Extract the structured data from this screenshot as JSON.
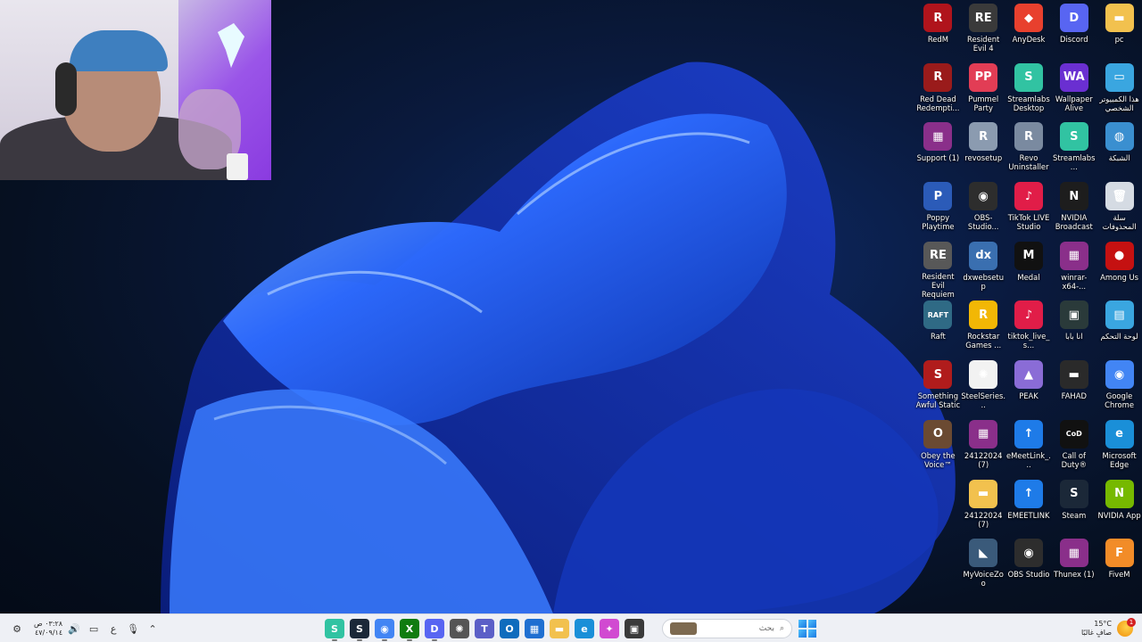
{
  "desktop": {
    "icons": [
      {
        "label": "RedM",
        "glyph": "R",
        "color": "#b0141c"
      },
      {
        "label": "Resident Evil 4",
        "glyph": "RE",
        "color": "#3a3a3a"
      },
      {
        "label": "AnyDesk",
        "glyph": "◆",
        "color": "#e8402e"
      },
      {
        "label": "Discord",
        "glyph": "D",
        "color": "#5865f2"
      },
      {
        "label": "pc",
        "glyph": "▬",
        "color": "#f2c14e"
      },
      {
        "label": "Red Dead Redempti...",
        "glyph": "R",
        "color": "#9a1b1b"
      },
      {
        "label": "Pummel Party",
        "glyph": "PP",
        "color": "#e23d55"
      },
      {
        "label": "Streamlabs Desktop",
        "glyph": "S",
        "color": "#31c3a2"
      },
      {
        "label": "Wallpaper Alive",
        "glyph": "WA",
        "color": "#6a2fd1"
      },
      {
        "label": "هذا الكمبيوتر الشخصي",
        "glyph": "▭",
        "color": "#3aa6e0"
      },
      {
        "label": "Support (1)",
        "glyph": "▦",
        "color": "#8a2f8a"
      },
      {
        "label": "revosetup",
        "glyph": "R",
        "color": "#8b9bb0"
      },
      {
        "label": "Revo Uninstaller",
        "glyph": "R",
        "color": "#7a8aa0"
      },
      {
        "label": "Streamlabs...",
        "glyph": "S",
        "color": "#31c3a2"
      },
      {
        "label": "الشبكة",
        "glyph": "◍",
        "color": "#3a8fd0"
      },
      {
        "label": "Poppy Playtime",
        "glyph": "P",
        "color": "#2b5bb8"
      },
      {
        "label": "OBS-Studio...",
        "glyph": "◉",
        "color": "#2d2d2d"
      },
      {
        "label": "TikTok LIVE Studio",
        "glyph": "♪",
        "color": "#e11d48"
      },
      {
        "label": "NVIDIA Broadcast",
        "glyph": "N",
        "color": "#1d1d1d"
      },
      {
        "label": "سلة المحذوفات",
        "glyph": "🗑",
        "color": "#d5dbe3"
      },
      {
        "label": "Resident Evil Requiem",
        "glyph": "RE",
        "color": "#585858"
      },
      {
        "label": "dxwebsetup",
        "glyph": "dx",
        "color": "#3a6fb0"
      },
      {
        "label": "Medal",
        "glyph": "M",
        "color": "#111111"
      },
      {
        "label": "winrar-x64-...",
        "glyph": "▦",
        "color": "#8a2f8a"
      },
      {
        "label": "Among Us",
        "glyph": "●",
        "color": "#c51111"
      },
      {
        "label": "Raft",
        "glyph": "RAFT",
        "color": "#2f6a85"
      },
      {
        "label": "Rockstar Games ...",
        "glyph": "R",
        "color": "#f2b705"
      },
      {
        "label": "tiktok_live_s...",
        "glyph": "♪",
        "color": "#e11d48"
      },
      {
        "label": "انا بابا",
        "glyph": "▣",
        "color": "#2a3a3a"
      },
      {
        "label": "لوحة التحكم",
        "glyph": "▤",
        "color": "#3aa6e0"
      },
      {
        "label": "Something Awful Static",
        "glyph": "S",
        "color": "#b01c1c"
      },
      {
        "label": "SteelSeries...",
        "glyph": "✺",
        "color": "#f2f2f2"
      },
      {
        "label": "PEAK",
        "glyph": "▲",
        "color": "#8a6cd6"
      },
      {
        "label": "FAHAD",
        "glyph": "▬",
        "color": "#2a2a2a"
      },
      {
        "label": "Google Chrome",
        "glyph": "◉",
        "color": "#4285f4"
      },
      {
        "label": "Obey the Voice™",
        "glyph": "O",
        "color": "#6b4a32"
      },
      {
        "label": "24122024 (7)",
        "glyph": "▦",
        "color": "#8a2f8a"
      },
      {
        "label": "eMeetLink_...",
        "glyph": "↑",
        "color": "#1e7be8"
      },
      {
        "label": "Call of Duty®",
        "glyph": "CoD",
        "color": "#111111"
      },
      {
        "label": "Microsoft Edge",
        "glyph": "e",
        "color": "#1a8fd8"
      },
      {
        "label": "",
        "glyph": "",
        "color": ""
      },
      {
        "label": "24122024 (7)",
        "glyph": "▬",
        "color": "#f2c14e"
      },
      {
        "label": "EMEETLINK",
        "glyph": "↑",
        "color": "#1e7be8"
      },
      {
        "label": "Steam",
        "glyph": "S",
        "color": "#1b2838"
      },
      {
        "label": "NVIDIA App",
        "glyph": "N",
        "color": "#76b900"
      },
      {
        "label": "",
        "glyph": "",
        "color": ""
      },
      {
        "label": "MyVoiceZoo",
        "glyph": "◣",
        "color": "#3a5a7a"
      },
      {
        "label": "OBS Studio",
        "glyph": "◉",
        "color": "#2d2d2d"
      },
      {
        "label": "Thunex (1)",
        "glyph": "▦",
        "color": "#8a2f8a"
      },
      {
        "label": "FiveM",
        "glyph": "F",
        "color": "#f28c28"
      }
    ]
  },
  "taskbar": {
    "clock": {
      "time": "٠٣:٢٨ ص",
      "date": "٤٧/٠٩/١٤"
    },
    "tray": {
      "lang": "ع"
    },
    "search": {
      "placeholder": "بحث"
    },
    "weather": {
      "temp": "15°C",
      "condition": "صافٍ غالبًا",
      "badge": "1"
    },
    "apps": [
      {
        "name": "streamlabs-app",
        "glyph": "S",
        "color": "#31c3a2",
        "active": true
      },
      {
        "name": "steam-app",
        "glyph": "S",
        "color": "#1b2838",
        "active": true
      },
      {
        "name": "chrome-app",
        "glyph": "◉",
        "color": "#4285f4",
        "active": true
      },
      {
        "name": "xbox-app",
        "glyph": "X",
        "color": "#107c10",
        "active": true
      },
      {
        "name": "discord-app",
        "glyph": "D",
        "color": "#5865f2",
        "active": true
      },
      {
        "name": "steelseries-app",
        "glyph": "✺",
        "color": "#555555",
        "active": false
      },
      {
        "name": "teams-app",
        "glyph": "T",
        "color": "#5b5fc7",
        "active": false
      },
      {
        "name": "outlook-app",
        "glyph": "O",
        "color": "#0f6cbd",
        "active": false
      },
      {
        "name": "store-app",
        "glyph": "▦",
        "color": "#1f6fd1",
        "active": false
      },
      {
        "name": "file-explorer-app",
        "glyph": "▬",
        "color": "#f2c14e",
        "active": false
      },
      {
        "name": "edge-app",
        "glyph": "e",
        "color": "#1a8fd8",
        "active": false
      },
      {
        "name": "copilot-app",
        "glyph": "✦",
        "color": "#d14ad1",
        "active": false
      },
      {
        "name": "widget-app",
        "glyph": "▣",
        "color": "#3a3a3a",
        "active": false
      }
    ]
  }
}
